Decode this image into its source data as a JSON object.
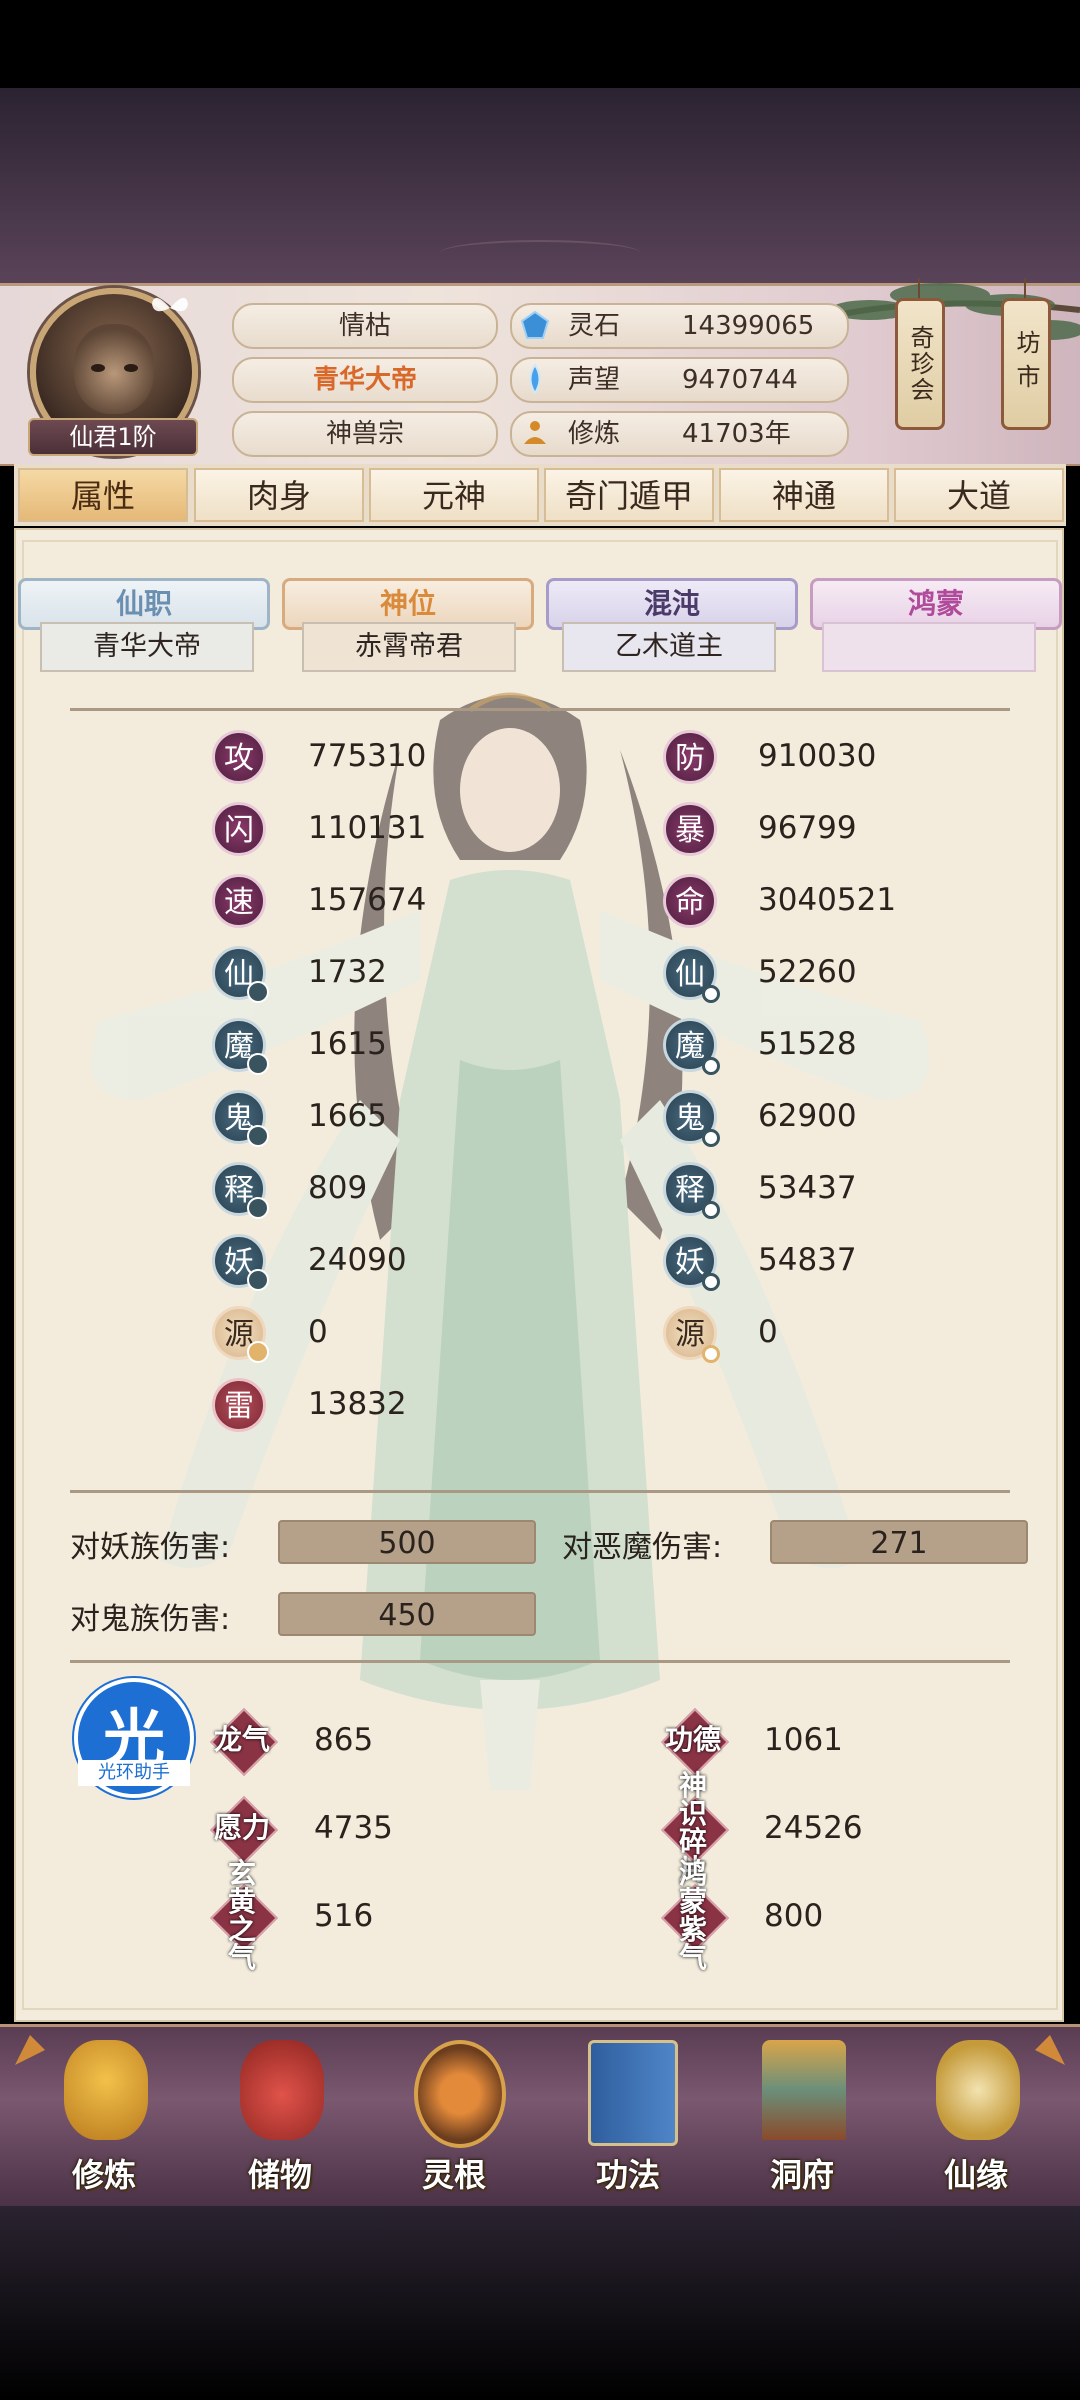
{
  "player": {
    "rank": "仙君1阶",
    "names": [
      "情枯",
      "青华大帝",
      "神兽宗"
    ],
    "highlight_color": "#d9682b"
  },
  "resources": [
    {
      "label": "灵石",
      "value": "14399065",
      "icon": "spirit-stone-icon"
    },
    {
      "label": "声望",
      "value": "9470744",
      "icon": "reputation-crystal-icon"
    },
    {
      "label": "修炼",
      "value": "41703年",
      "icon": "meditation-icon"
    }
  ],
  "side_buttons": [
    "奇珍会",
    "坊市"
  ],
  "tabs": [
    "属性",
    "肉身",
    "元神",
    "奇门遁甲",
    "神通",
    "大道"
  ],
  "active_tab": "属性",
  "ranks": [
    {
      "title": "仙职",
      "value": "青华大帝",
      "color": "#6b8fb0"
    },
    {
      "title": "神位",
      "value": "赤霄帝君",
      "color": "#d98a3a"
    },
    {
      "title": "混沌",
      "value": "乙木道主",
      "color": "#4a3a6a"
    },
    {
      "title": "鸿蒙",
      "value": "",
      "color": "#b04a9a"
    }
  ],
  "stats_left": [
    {
      "name": "攻",
      "value": "775310"
    },
    {
      "name": "闪",
      "value": "110131"
    },
    {
      "name": "速",
      "value": "157674"
    },
    {
      "name": "仙",
      "value": "1732"
    },
    {
      "name": "魔",
      "value": "1615"
    },
    {
      "name": "鬼",
      "value": "1665"
    },
    {
      "name": "释",
      "value": "809"
    },
    {
      "name": "妖",
      "value": "24090"
    },
    {
      "name": "源",
      "value": "0"
    },
    {
      "name": "雷",
      "value": "13832"
    }
  ],
  "stats_right": [
    {
      "name": "防",
      "value": "910030"
    },
    {
      "name": "暴",
      "value": "96799"
    },
    {
      "name": "命",
      "value": "3040521"
    },
    {
      "name": "仙",
      "value": "52260"
    },
    {
      "name": "魔",
      "value": "51528"
    },
    {
      "name": "鬼",
      "value": "62900"
    },
    {
      "name": "释",
      "value": "53437"
    },
    {
      "name": "妖",
      "value": "54837"
    },
    {
      "name": "源",
      "value": "0"
    }
  ],
  "damage": [
    {
      "label": "对妖族伤害:",
      "value": "500"
    },
    {
      "label": "对恶魔伤害:",
      "value": "271"
    },
    {
      "label": "对鬼族伤害:",
      "value": "450"
    }
  ],
  "extra": [
    {
      "name": "龙气",
      "value": "865"
    },
    {
      "name": "功德",
      "value": "1061"
    },
    {
      "name": "愿力",
      "value": "4735"
    },
    {
      "name": "神识碎片",
      "value": "24526"
    },
    {
      "name": "玄黄之气",
      "value": "516"
    },
    {
      "name": "鸿蒙紫气",
      "value": "800"
    }
  ],
  "helper": {
    "big": "光",
    "small": "光环助手"
  },
  "bottom_nav": [
    "修炼",
    "储物",
    "灵根",
    "功法",
    "洞府",
    "仙缘"
  ]
}
